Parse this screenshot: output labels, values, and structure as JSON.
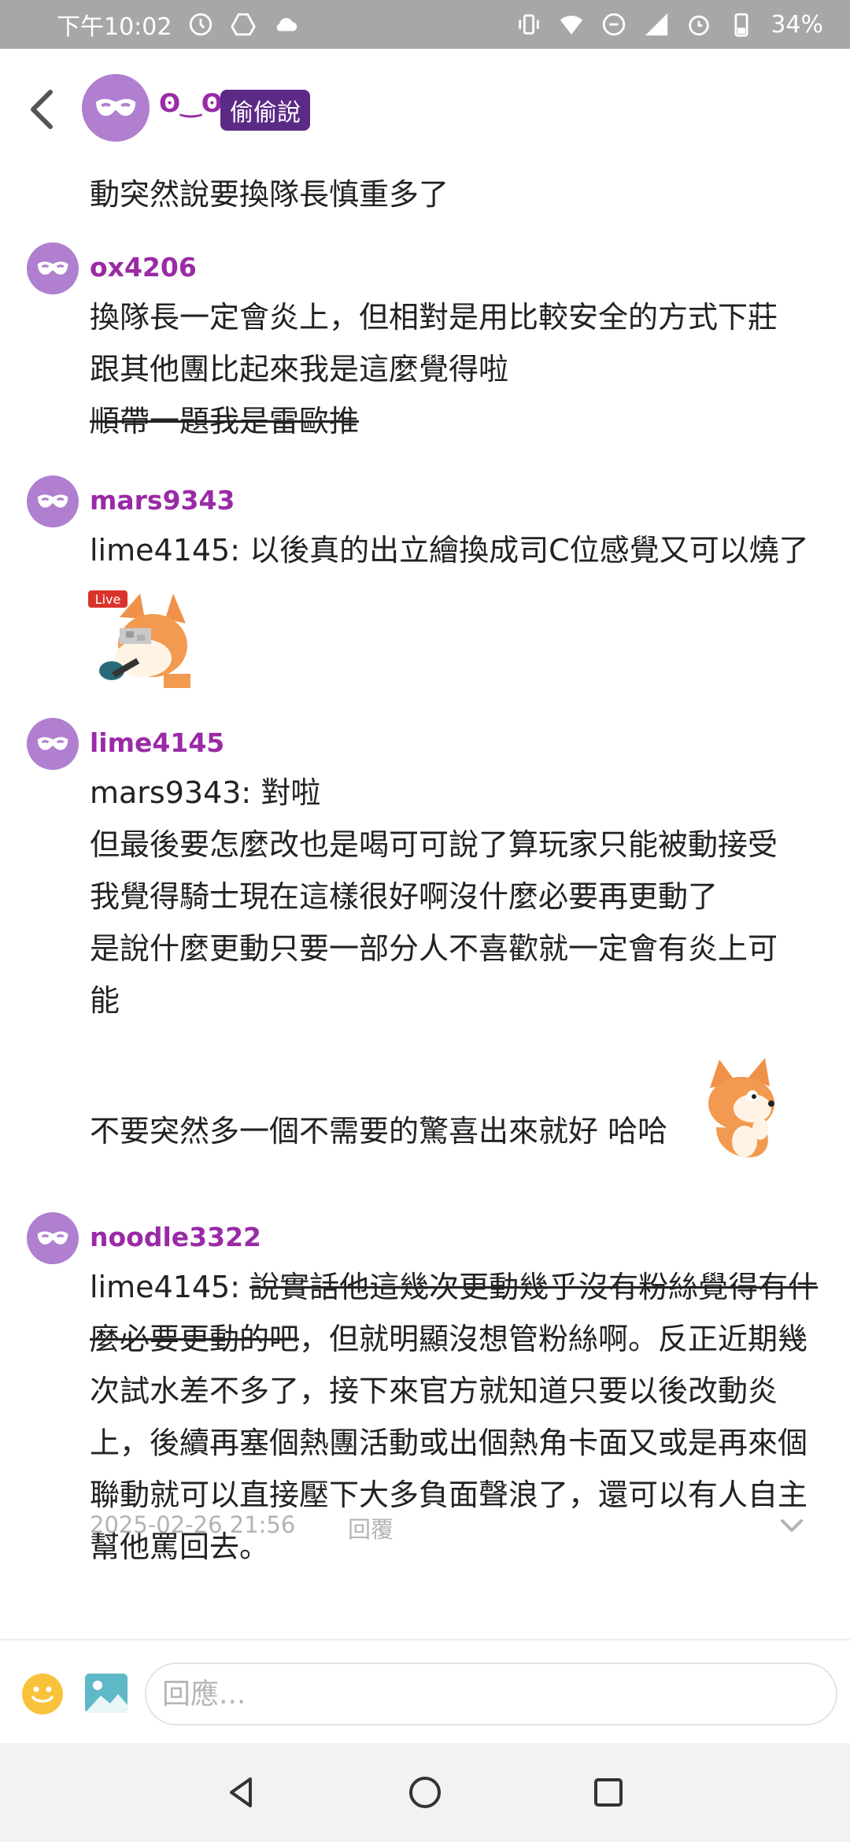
{
  "status_bar": {
    "time": "下午10:02",
    "battery": "34%"
  },
  "thread": {
    "op": {
      "name": "ʘ‿ʘ",
      "badge": "偷偷說",
      "text": "動突然說要換隊長慎重多了"
    },
    "comments": [
      {
        "name": "ox4206",
        "lines": [
          "換隊長一定會炎上，但相對是用比較安全的方式下莊",
          "跟其他團比起來我是這麼覺得啦"
        ],
        "strike_line": "順帶一題我是雷歐推"
      },
      {
        "name": "mars9343",
        "lines": [
          "lime4145: 以後真的出立繪換成司C位感覺又可以燒了"
        ],
        "sticker_label": "Live"
      },
      {
        "name": "lime4145",
        "lines": [
          "mars9343: 對啦",
          "但最後要怎麼改也是喝可可說了算玩家只能被動接受",
          "我覺得騎士現在這樣很好啊沒什麼必要再更動了",
          "是說什麼更動只要一部分人不喜歡就一定會有炎上可",
          "能"
        ],
        "tail_line": "不要突然多一個不需要的驚喜出來就好 哈哈"
      },
      {
        "name": "noodle3322",
        "prefix": "lime4145: ",
        "strike_part": "說實話他這幾次更動幾乎沒有粉絲覺得有什麼必要更動的吧",
        "rest": "，但就明顯沒想管粉絲啊。反正近期幾次試水差不多了，接下來官方就知道只要以後改動炎上，後續再塞個熱團活動或出個熱角卡面又或是再來個聯動就可以直接壓下大多負面聲浪了，還可以有人自主幫他罵回去。",
        "timestamp": "2025-02-26 21:56",
        "reply_label": "回覆"
      }
    ]
  },
  "composer": {
    "placeholder": "回應..."
  },
  "icons": {
    "avatar": "mask-icon",
    "back": "chevron-left-icon",
    "emoji": "emoji-icon",
    "image": "image-icon",
    "expand": "chevron-down-icon"
  },
  "colors": {
    "username": "#9a2aa6",
    "badge_bg": "#5b2a86",
    "avatar_bg": "#b07fd0",
    "status_bar": "#a7a7a7"
  }
}
